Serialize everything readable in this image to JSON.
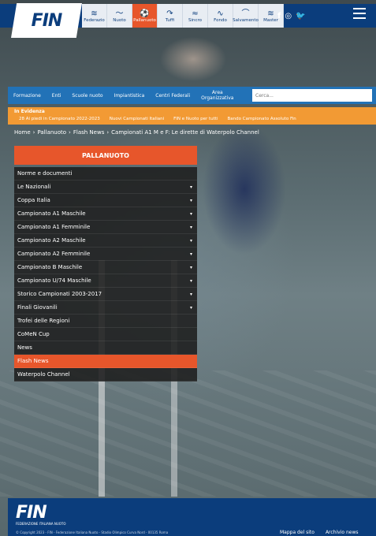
{
  "header": {
    "logo": "FIN",
    "disciplines": [
      {
        "label": "Federazio",
        "icon": "fin-icon",
        "glyph": "≋"
      },
      {
        "label": "Nuoto",
        "icon": "swimmer-icon",
        "glyph": "〜"
      },
      {
        "label": "Pallanuoto",
        "icon": "waterpolo-icon",
        "glyph": "⚽"
      },
      {
        "label": "Tuffi",
        "icon": "diver-icon",
        "glyph": "↷"
      },
      {
        "label": "Sincro",
        "icon": "synchro-icon",
        "glyph": "≈"
      },
      {
        "label": "Fondo",
        "icon": "open-water-icon",
        "glyph": "∿"
      },
      {
        "label": "Salvamento",
        "icon": "lifesaving-icon",
        "glyph": "⌒"
      },
      {
        "label": "Master",
        "icon": "master-icon",
        "glyph": "≋"
      }
    ],
    "social": [
      "f",
      "◎",
      "🐦"
    ]
  },
  "mainnav": {
    "items": [
      "Formazione",
      "Enti",
      "Scuole nuoto",
      "Impiantistica",
      "Centri Federali"
    ],
    "stacked_item": [
      "Area",
      "Organizzativa"
    ],
    "search_placeholder": "Cerca...",
    "search_icon": "search-icon"
  },
  "highlight": {
    "title": "In Evidenza",
    "items": [
      "28 Ai piedi in Campionato 2022-2023",
      "Nuovi Campionati Italiani",
      "FIN e Nuoto per tutti",
      "Bando Campionato Assoluto Fin"
    ]
  },
  "breadcrumb": [
    "Home",
    "Pallanuoto",
    "Flash News",
    "Campionati A1 M e F: Le dirette di Waterpolo Channel"
  ],
  "sidebar": {
    "title": "PALLANUOTO",
    "items": [
      {
        "label": "Norme e documenti",
        "caret": false,
        "active": false
      },
      {
        "label": "Le Nazionali",
        "caret": true,
        "active": false
      },
      {
        "label": "Coppa Italia",
        "caret": true,
        "active": false
      },
      {
        "label": "Campionato A1 Maschile",
        "caret": true,
        "active": false
      },
      {
        "label": "Campionato A1 Femminile",
        "caret": true,
        "active": false
      },
      {
        "label": "Campionato A2 Maschile",
        "caret": true,
        "active": false
      },
      {
        "label": "Campionato A2 Femminile",
        "caret": true,
        "active": false
      },
      {
        "label": "Campionato B Maschile",
        "caret": true,
        "active": false
      },
      {
        "label": "Campionato U/74 Maschile",
        "caret": true,
        "active": false
      },
      {
        "label": "Storico Campionati 2003-2017",
        "caret": true,
        "active": false
      },
      {
        "label": "Finali Giovanili",
        "caret": true,
        "active": false
      },
      {
        "label": "Trofei delle Regioni",
        "caret": false,
        "active": false
      },
      {
        "label": "CoMeN Cup",
        "caret": false,
        "active": false
      },
      {
        "label": "News",
        "caret": false,
        "active": false
      },
      {
        "label": "Flash News",
        "caret": false,
        "active": true
      },
      {
        "label": "Waterpolo Channel",
        "caret": false,
        "active": false
      }
    ]
  },
  "footer": {
    "logo": "FIN",
    "subtitle": "FEDERAZIONE ITALIANA NUOTO",
    "copyright": "© Copyright 2023 - FIN - Federazione Italiana Nuoto - Stadio Olimpico Curva Nord - 00135 Roma",
    "links": [
      "Mappa del sito",
      "Archivio news"
    ]
  },
  "colors": {
    "brand_blue": "#0b3d7c",
    "nav_blue": "#2272b7",
    "accent_orange": "#e7562b",
    "highlight_orange": "#f29a34"
  }
}
